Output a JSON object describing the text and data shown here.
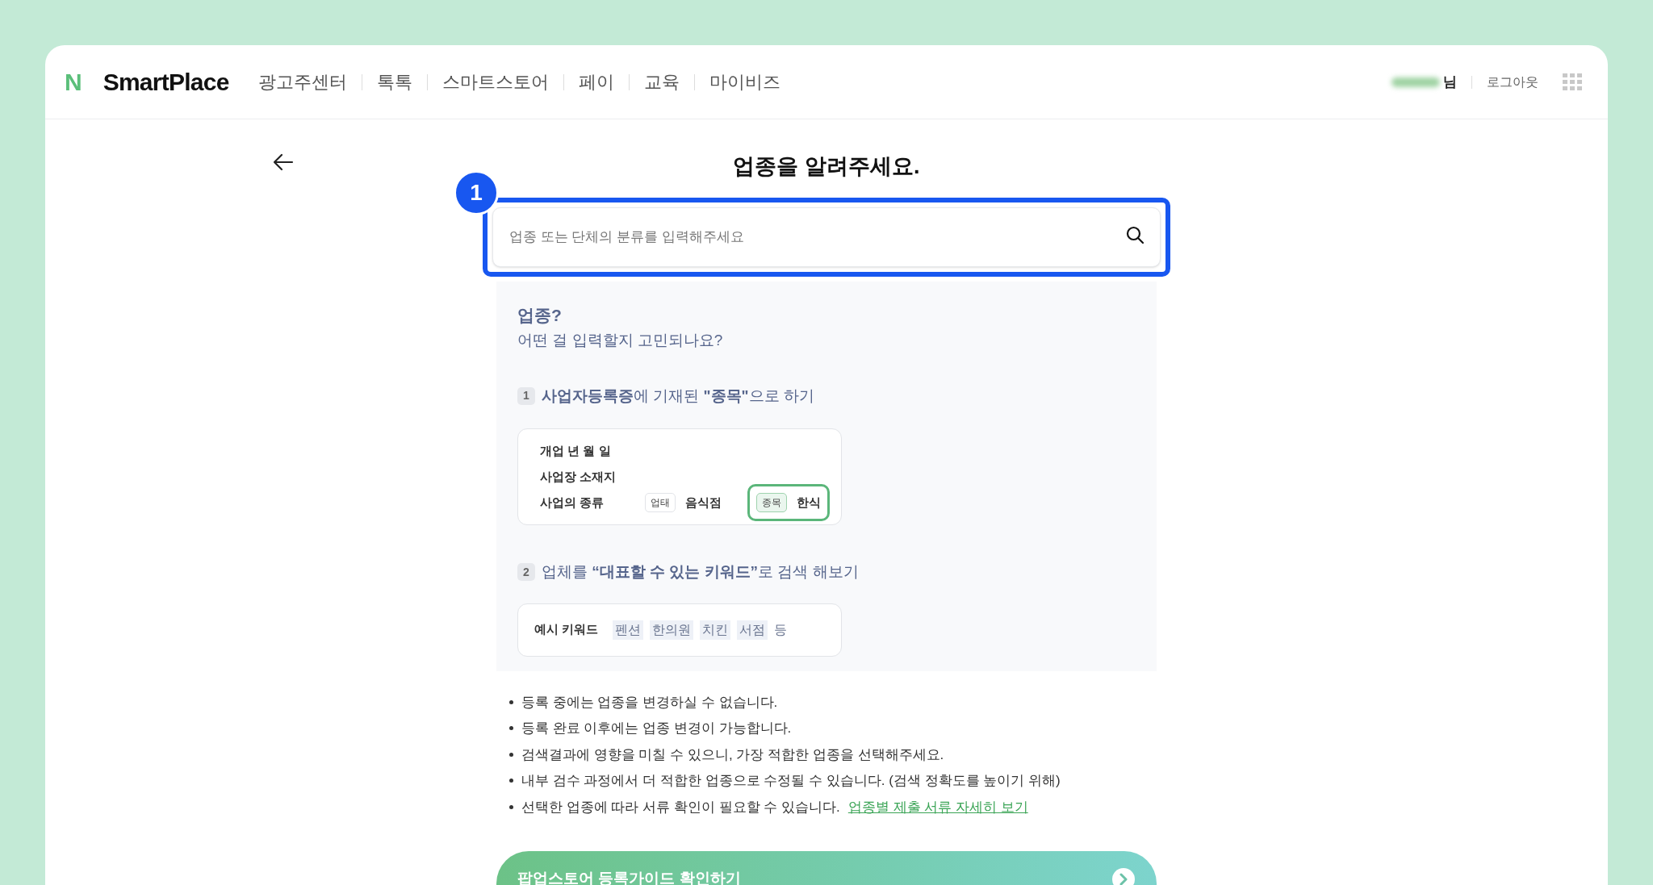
{
  "header": {
    "logo_mark": "N",
    "logo_text": "SmartPlace",
    "nav": [
      "광고주센터",
      "톡톡",
      "스마트스토어",
      "페이",
      "교육",
      "마이비즈"
    ],
    "user_suffix": "님",
    "logout": "로그아웃"
  },
  "page": {
    "title": "업종을 알려주세요.",
    "step_badge": "1",
    "search": {
      "placeholder": "업종 또는 단체의 분류를 입력해주세요"
    }
  },
  "help": {
    "title": "업종?",
    "subtitle": "어떤 걸 입력할지 고민되나요?",
    "step1": {
      "number": "1",
      "text": "**사업자등록증**에 기재된 **\"종목\"**으로 하기",
      "rows": [
        "개업 년 월 일",
        "사업장 소재지",
        "사업의 종류"
      ],
      "type_tag": "업태",
      "type_value": "음식점",
      "item_tag": "종목",
      "item_value": "한식"
    },
    "step2": {
      "number": "2",
      "text": "업체를 **“대표할 수 있는 키워드”**로 검색 해보기",
      "label": "예시 키워드",
      "keywords": [
        "펜션",
        "한의원",
        "치킨",
        "서점"
      ],
      "suffix": "등"
    }
  },
  "notes": [
    "등록 중에는 업종을 변경하실 수 없습니다.",
    "등록 완료 이후에는 업종 변경이 가능합니다.",
    "검색결과에 영향을 미칠 수 있으니, 가장 적합한 업종을 선택해주세요.",
    "내부 검수 과정에서 더 적합한 업종으로 수정될 수 있습니다. (검색 정확도를 높이기 위해)",
    "선택한 업종에 따라 서류 확인이 필요할 수 있습니다."
  ],
  "notes_link": "업종별 제출 서류 자세히 보기",
  "guide_button": "팝업스토어 등록가이드 확인하기"
}
